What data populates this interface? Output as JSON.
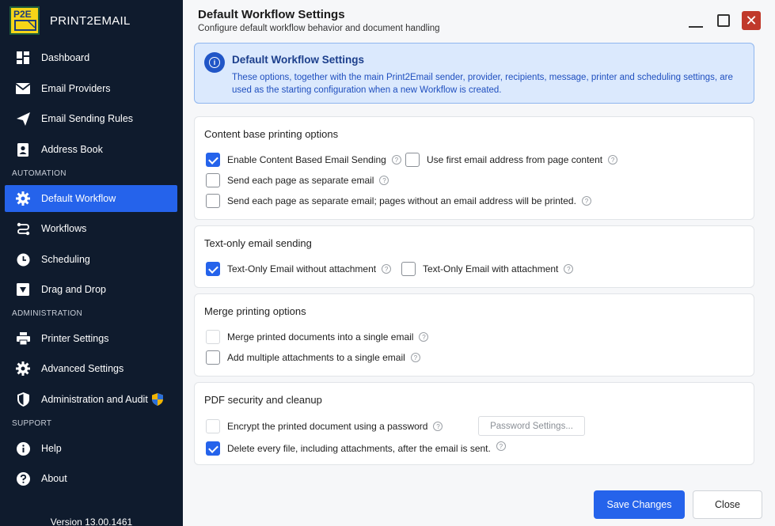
{
  "app": {
    "brand_logo_text": "P2E",
    "brand_name": "PRINT2EMAIL",
    "version": "Version 13.00.1461"
  },
  "sidebar": {
    "items_top": [
      {
        "label": "Dashboard",
        "icon": "dashboard-icon"
      },
      {
        "label": "Email Providers",
        "icon": "envelope-icon"
      },
      {
        "label": "Email Sending Rules",
        "icon": "paper-plane-icon"
      },
      {
        "label": "Address Book",
        "icon": "contact-book-icon"
      }
    ],
    "section_automation": "AUTOMATION",
    "items_automation": [
      {
        "label": "Default Workflow",
        "icon": "gear-icon",
        "active": true
      },
      {
        "label": "Workflows",
        "icon": "workflow-icon"
      },
      {
        "label": "Scheduling",
        "icon": "clock-icon"
      },
      {
        "label": "Drag and Drop",
        "icon": "dropdown-box-icon"
      }
    ],
    "section_administration": "ADMINISTRATION",
    "items_administration": [
      {
        "label": "Printer Settings",
        "icon": "printer-icon"
      },
      {
        "label": "Advanced Settings",
        "icon": "gear-icon"
      },
      {
        "label": "Administration and Audit",
        "icon": "shield-icon"
      }
    ],
    "section_support": "SUPPORT",
    "items_support": [
      {
        "label": "Help",
        "icon": "info-icon"
      },
      {
        "label": "About",
        "icon": "question-icon"
      }
    ]
  },
  "header": {
    "title": "Default Workflow Settings",
    "subtitle": "Configure default workflow behavior and document handling"
  },
  "info": {
    "title": "Default Workflow Settings",
    "text": "These options, together with the main Print2Email sender, provider, recipients, message, printer and scheduling settings, are used as the starting configuration when a new Workflow is created."
  },
  "sections": {
    "content": {
      "title": "Content base printing options",
      "enable_content": {
        "label": "Enable Content Based Email Sending",
        "checked": true
      },
      "use_first_email": {
        "label": "Use first email address from page content",
        "checked": false
      },
      "each_page": {
        "label": "Send each page as separate email",
        "checked": false
      },
      "each_page_print": {
        "label": "Send each page as separate email; pages without an email address will be printed.",
        "checked": false
      }
    },
    "text_only": {
      "title": "Text-only email sending",
      "without_attachment": {
        "label": "Text-Only Email without attachment",
        "checked": true
      },
      "with_attachment": {
        "label": "Text-Only Email with attachment",
        "checked": false
      }
    },
    "merge": {
      "title": "Merge printing options",
      "merge_single": {
        "label": "Merge printed documents into a single email",
        "checked": false,
        "disabled": true
      },
      "multiple_attachments": {
        "label": "Add multiple attachments to a single email",
        "checked": false
      }
    },
    "pdf": {
      "title": "PDF security and cleanup",
      "encrypt": {
        "label": "Encrypt the printed document using a password",
        "checked": false,
        "disabled": true
      },
      "password_button": "Password Settings...",
      "delete_files": {
        "label": "Delete every file, including attachments, after the email is sent.",
        "checked": true
      }
    }
  },
  "footer": {
    "save": "Save Changes",
    "close": "Close"
  },
  "colors": {
    "sidebar_bg": "#0f1b2d",
    "accent": "#2563eb",
    "info_bg": "#dbe9fd",
    "close_red": "#c0392b"
  }
}
